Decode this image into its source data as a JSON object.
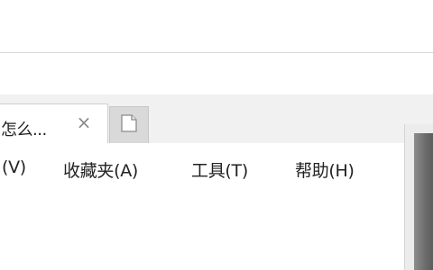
{
  "tab": {
    "title": "怎么...",
    "close_icon": "close-icon"
  },
  "new_tab": {
    "icon": "new-tab-icon"
  },
  "menu": {
    "items": [
      {
        "label": "(V)"
      },
      {
        "label": "收藏夹(A)"
      },
      {
        "label": "工具(T)"
      },
      {
        "label": "帮助(H)"
      }
    ]
  },
  "colors": {
    "tab_strip": "#f1f1f1",
    "new_tab_bg": "#d9d9d9",
    "scroll_thumb": "#6a6a6a"
  }
}
